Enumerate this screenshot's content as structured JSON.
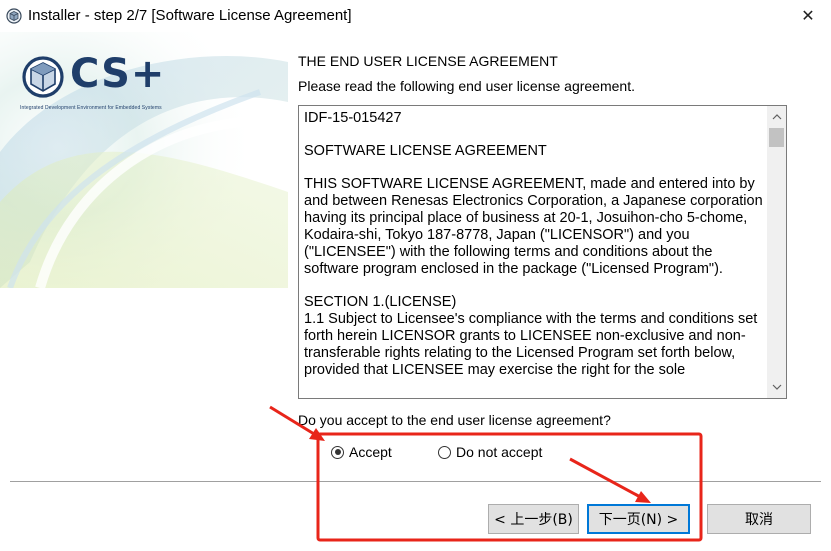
{
  "window": {
    "title": "Installer - step 2/7 [Software License Agreement]",
    "close_glyph": "✕"
  },
  "branding": {
    "logo_text": "CS+",
    "logo_tagline": "Integrated Development Environment for Embedded Systems",
    "logo_icon": "cube-in-circle-icon",
    "accent_color": "#1f3e6a"
  },
  "main": {
    "heading": "THE END USER LICENSE AGREEMENT",
    "subheading": "Please read the following end user license agreement."
  },
  "license": {
    "paragraphs": [
      "IDF-15-015427",
      "SOFTWARE LICENSE AGREEMENT",
      "THIS SOFTWARE LICENSE AGREEMENT, made and entered into by and between Renesas Electronics Corporation, a Japanese corporation having its principal place of business at 20-1, Josuihon-cho 5-chome, Kodaira-shi, Tokyo 187-8778, Japan (\"LICENSOR\") and you (\"LICENSEE\") with the following terms and conditions about the software program enclosed in the package (\"Licensed Program\").",
      "SECTION 1.(LICENSE)",
      "1.1  Subject to Licensee's compliance with the terms and conditions set forth herein  LICENSOR grants to LICENSEE non-exclusive and non-transferable rights relating to the Licensed Program set forth below, provided that LICENSEE may exercise the right for the sole"
    ],
    "scroll_up_glyph": "⌃",
    "scroll_down_glyph": "⌄"
  },
  "acceptance": {
    "question": "Do you accept to the end user license agreement?",
    "accept_label": "Accept",
    "decline_label": "Do not accept",
    "selected": "accept"
  },
  "buttons": {
    "back_label": "< 上一步(B)",
    "next_label": "下一页(N) >",
    "cancel_label": "取消"
  },
  "annotation": {
    "color": "#e8251a"
  }
}
